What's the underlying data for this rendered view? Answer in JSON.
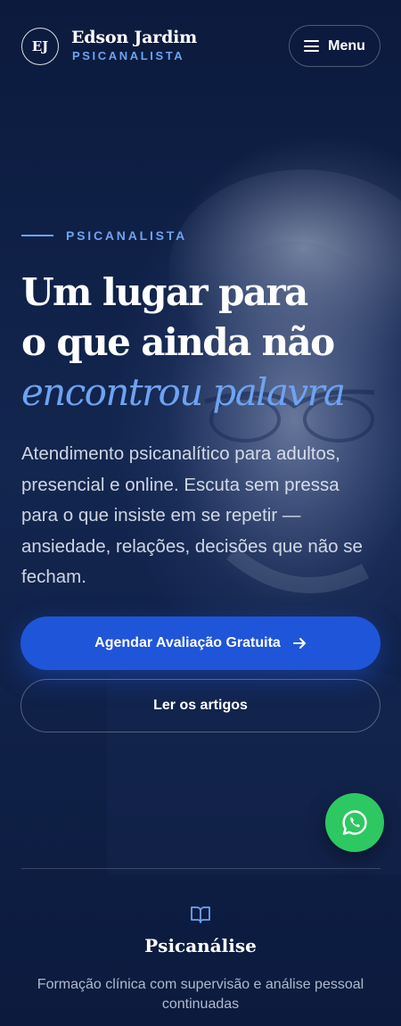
{
  "header": {
    "logo_initials": "EJ",
    "brand_name": "Edson Jardim",
    "brand_role": "PSICANALISTA",
    "menu_label": "Menu"
  },
  "hero": {
    "eyebrow": "PSICANALISTA",
    "headline_line1": "Um lugar para",
    "headline_line2": "o que ainda não",
    "headline_accent": "encontrou palavra",
    "lead": "Atendimento psicanalítico para adultos, presencial e online. Escuta sem pressa para o que insiste em se repetir — ansiedade, relações, decisões que não se fecham.",
    "primary_cta": "Agendar Avaliação Gratuita",
    "secondary_cta": "Ler os artigos"
  },
  "feature": {
    "icon": "book-icon",
    "title": "Psicanálise",
    "description": "Formação clínica com supervisão e análise pessoal continuadas"
  },
  "floating": {
    "icon": "whatsapp-icon"
  },
  "colors": {
    "background": "#0b1a3d",
    "accent": "#6ea3f2",
    "primary_button": "#1f55d9",
    "whatsapp": "#2dc862"
  }
}
